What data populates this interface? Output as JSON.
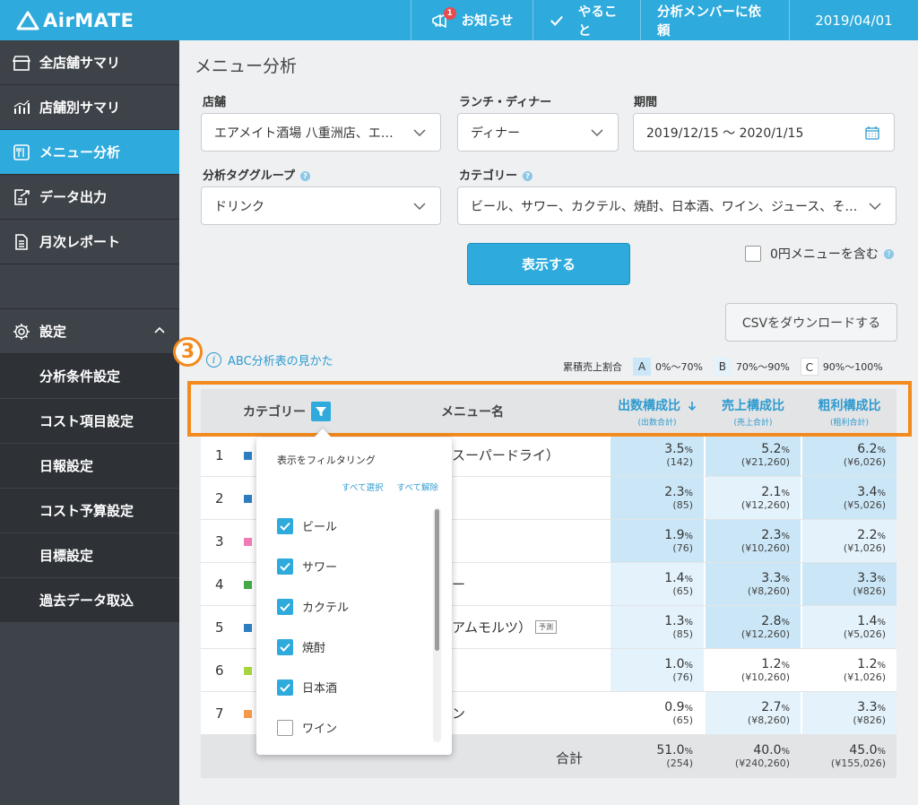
{
  "app": {
    "name": "AirMATE"
  },
  "header": {
    "news_label": "お知らせ",
    "news_badge": "1",
    "todo_label": "やること",
    "request_label": "分析メンバーに依頼",
    "date": "2019/04/01"
  },
  "sidebar": {
    "items": [
      {
        "label": "全店舗サマリ",
        "icon": "store-icon"
      },
      {
        "label": "店舗別サマリ",
        "icon": "bar-chart-icon"
      },
      {
        "label": "メニュー分析",
        "icon": "menu-book-icon",
        "active": true
      },
      {
        "label": "データ出力",
        "icon": "export-icon"
      },
      {
        "label": "月次レポート",
        "icon": "report-icon"
      }
    ],
    "settings_label": "設定",
    "sub_items": [
      "分析条件設定",
      "コスト項目設定",
      "日報設定",
      "コスト予算設定",
      "目標設定",
      "過去データ取込"
    ]
  },
  "page": {
    "title": "メニュー分析"
  },
  "filters": {
    "store_label": "店舗",
    "store_value": "エアメイト酒場 八重洲店、エアメイト酒場",
    "lunch_label": "ランチ・ディナー",
    "lunch_value": "ディナー",
    "period_label": "期間",
    "period_value": "2019/12/15 〜 2020/1/15",
    "group_label": "分析タググループ",
    "group_value": "ドリンク",
    "category_label": "カテゴリー",
    "category_value": "ビール、サワー、カクテル、焼酎、日本酒、ワイン、ジュース、その他",
    "show_button": "表示する",
    "zero_menu_label": "0円メニューを含む",
    "csv_button": "CSVをダウンロードする"
  },
  "abc": {
    "step_number": "3",
    "help_link": "ABC分析表の見かた",
    "legend_label": "累積売上割合",
    "legend": [
      {
        "key": "A",
        "range": "0%〜70%"
      },
      {
        "key": "B",
        "range": "70%〜90%"
      },
      {
        "key": "C",
        "range": "90%〜100%"
      }
    ]
  },
  "table": {
    "headers": {
      "category": "カテゴリー",
      "menu": "メニュー名",
      "qty": "出数構成比",
      "qty_sub": "(出数合計)",
      "sales": "売上構成比",
      "sales_sub": "(売上合計)",
      "profit": "粗利構成比",
      "profit_sub": "(粗利合計)"
    },
    "rows": [
      {
        "no": "1",
        "color": "#2f7dc1",
        "name": "スーパードライ）",
        "tag": "",
        "qty": "3.5",
        "qty_sub": "(142)",
        "sales": "5.2",
        "sales_sub": "(¥21,260)",
        "profit": "6.2",
        "profit_sub": "(¥6,026)",
        "bg": [
          "A",
          "A",
          "A"
        ]
      },
      {
        "no": "2",
        "color": "#2f7dc1",
        "name": "",
        "tag": "",
        "qty": "2.3",
        "qty_sub": "(85)",
        "sales": "2.1",
        "sales_sub": "(¥12,260)",
        "profit": "3.4",
        "profit_sub": "(¥5,026)",
        "bg": [
          "A",
          "B",
          "A"
        ]
      },
      {
        "no": "3",
        "color": "#f07cb4",
        "name": "",
        "tag": "",
        "qty": "1.9",
        "qty_sub": "(76)",
        "sales": "2.3",
        "sales_sub": "(¥10,260)",
        "profit": "2.2",
        "profit_sub": "(¥1,026)",
        "bg": [
          "A",
          "A",
          "B"
        ]
      },
      {
        "no": "4",
        "color": "#44a84a",
        "name": "ー",
        "tag": "",
        "qty": "1.4",
        "qty_sub": "(65)",
        "sales": "3.3",
        "sales_sub": "(¥8,260)",
        "profit": "3.3",
        "profit_sub": "(¥826)",
        "bg": [
          "B",
          "A",
          "A"
        ]
      },
      {
        "no": "5",
        "color": "#2f7dc1",
        "name": "アムモルツ）",
        "tag": "予測",
        "qty": "1.3",
        "qty_sub": "(85)",
        "sales": "2.8",
        "sales_sub": "(¥12,260)",
        "profit": "1.4",
        "profit_sub": "(¥5,026)",
        "bg": [
          "B",
          "A",
          "B"
        ]
      },
      {
        "no": "6",
        "color": "#a5d63f",
        "name": "",
        "tag": "",
        "qty": "1.0",
        "qty_sub": "(76)",
        "sales": "1.2",
        "sales_sub": "(¥10,260)",
        "profit": "1.2",
        "profit_sub": "(¥1,026)",
        "bg": [
          "B",
          "C",
          "C"
        ]
      },
      {
        "no": "7",
        "color": "#f4984a",
        "name": "ン",
        "tag": "",
        "qty": "0.9",
        "qty_sub": "(65)",
        "sales": "2.7",
        "sales_sub": "(¥8,260)",
        "profit": "3.3",
        "profit_sub": "(¥826)",
        "bg": [
          "C",
          "B",
          "B"
        ]
      }
    ],
    "footer": {
      "label": "合計",
      "qty": "51.0",
      "qty_sub": "(254)",
      "sales": "40.0",
      "sales_sub": "(¥240,260)",
      "profit": "45.0",
      "profit_sub": "(¥155,026)"
    },
    "percent_unit": "%"
  },
  "filter_popup": {
    "title": "表示をフィルタリング",
    "select_all": "すべて選択",
    "deselect_all": "すべて解除",
    "options": [
      {
        "label": "ビール",
        "checked": true
      },
      {
        "label": "サワー",
        "checked": true
      },
      {
        "label": "カクテル",
        "checked": true
      },
      {
        "label": "焼酎",
        "checked": true
      },
      {
        "label": "日本酒",
        "checked": true
      },
      {
        "label": "ワイン",
        "checked": false
      }
    ]
  },
  "colors": {
    "accent": "#2eaadc",
    "sidebar": "#3e4349",
    "highlight": "#f28a1e",
    "rank_a": "#cbe7f7",
    "rank_b": "#e3f2fb"
  }
}
